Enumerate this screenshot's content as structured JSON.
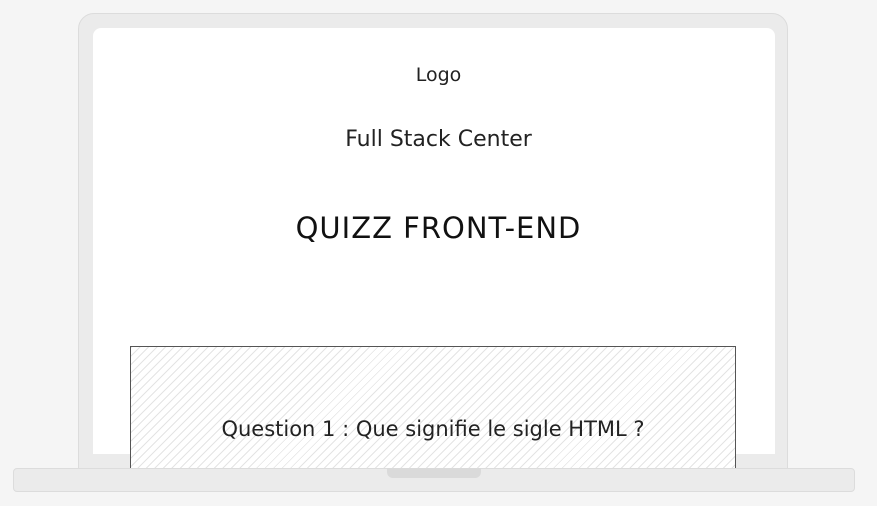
{
  "header": {
    "logo_text": "Logo",
    "brand_name": "Full Stack Center"
  },
  "main": {
    "title": "QUIZZ FRONT-END",
    "question": "Question 1 : Que signifie le sigle HTML ?"
  }
}
